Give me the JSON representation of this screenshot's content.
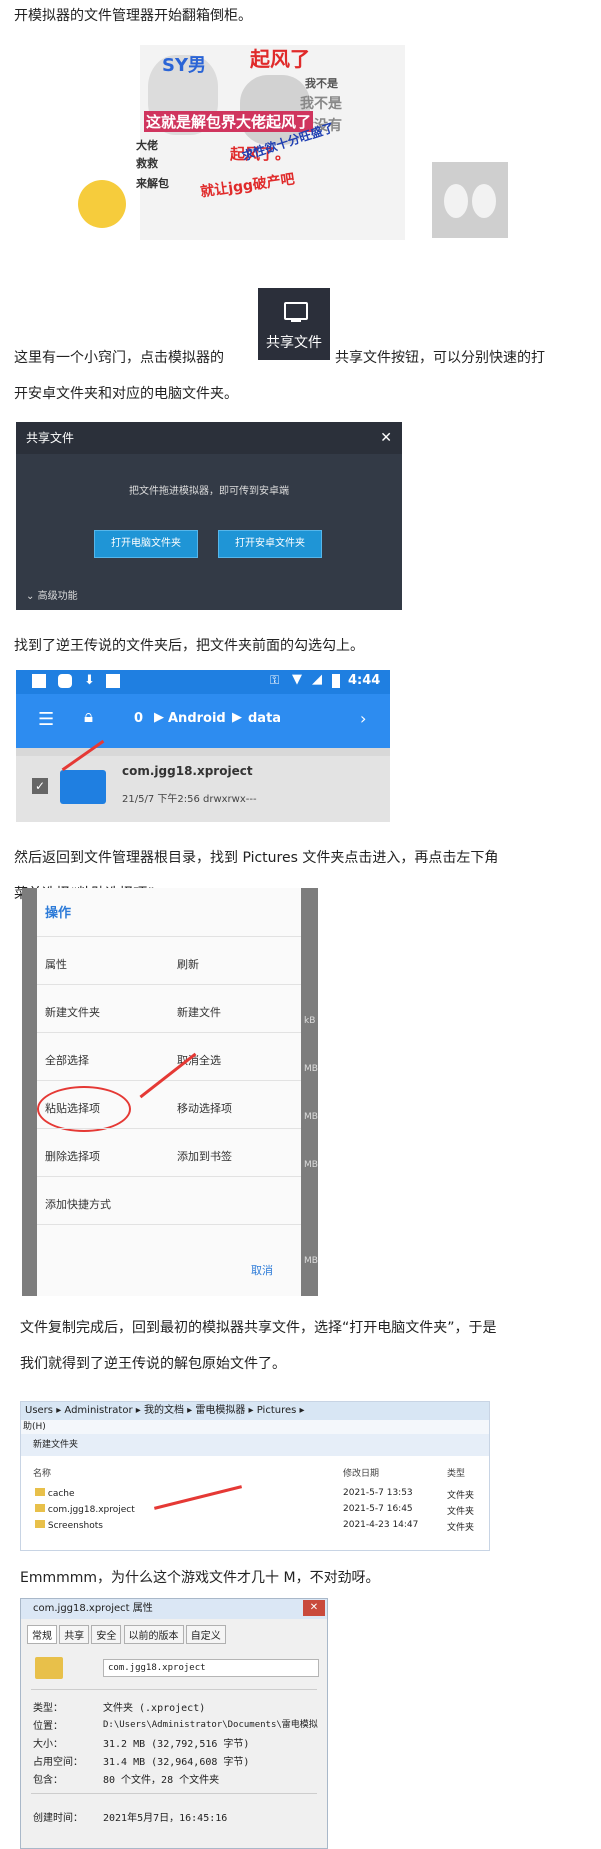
{
  "paragraphs": {
    "p1": "开模拟器的文件管理器开始翻箱倒柜。",
    "p2a": "这里有一个小窍门，点击模拟器的",
    "p2b": "共享文件按钮，可以分别快速的打",
    "p2c": "开安卓文件夹和对应的电脑文件夹。",
    "p3": "找到了逆王传说的文件夹后，把文件夹前面的勾选勾上。",
    "p4a": "然后返回到文件管理器根目录，找到 Pictures 文件夹点击进入，再点击左下角",
    "p4b": "菜单选择“粘贴选择项”。",
    "p5a": "文件复制完成后，回到最初的模拟器共享文件，选择“打开电脑文件夹”，于是",
    "p5b": "我们就得到了逆王传说的解包原始文件了。",
    "p6": "Emmmmm，为什么这个游戏文件才几十 M，不对劲呀。"
  },
  "meme": {
    "t1": "SY男",
    "t2": "起风了",
    "t3": "这就是解包界大佬起风了",
    "t4": "我不是",
    "t5": "我不是",
    "t6": "我没有",
    "t7": "起风了。",
    "t8": "求性欲十分旺盛了",
    "t9": "就让jgg破产吧",
    "t10": "大佬",
    "t11": "救救",
    "t12": "来解包"
  },
  "share_icon": {
    "label": "共享文件"
  },
  "share_dialog": {
    "title": "共享文件",
    "message": "把文件拖进模拟器，即可传到安卓端",
    "btn_pc": "打开电脑文件夹",
    "btn_android": "打开安卓文件夹",
    "advanced": "高级功能"
  },
  "android": {
    "time": "4:44",
    "count": "0",
    "path1": "Android",
    "path2": "data",
    "folder_name": "com.jgg18.xproject",
    "folder_meta": "21/5/7 下午2:56  drwxrwx---"
  },
  "ops_menu": {
    "title": "操作",
    "items": [
      "属性",
      "刷新",
      "新建文件夹",
      "新建文件",
      "全部选择",
      "取消全选",
      "粘贴选择项",
      "移动选择项",
      "删除选择项",
      "添加到书签",
      "添加快捷方式"
    ],
    "cancel": "取消",
    "sizes": [
      "kB",
      "MB",
      "MB",
      "MB",
      "MB"
    ]
  },
  "explorer": {
    "breadcrumb": [
      "Users",
      "Administrator",
      "我的文档",
      "雷电模拟器",
      "Pictures"
    ],
    "menu": "助(H)",
    "new_folder": "新建文件夹",
    "col_name": "名称",
    "col_date": "修改日期",
    "col_type": "类型",
    "rows": [
      {
        "name": "cache",
        "date": "2021-5-7 13:53",
        "type": "文件夹"
      },
      {
        "name": "com.jgg18.xproject",
        "date": "2021-5-7 16:45",
        "type": "文件夹"
      },
      {
        "name": "Screenshots",
        "date": "2021-4-23 14:47",
        "type": "文件夹"
      }
    ]
  },
  "props": {
    "title": "com.jgg18.xproject 属性",
    "tabs": [
      "常规",
      "共享",
      "安全",
      "以前的版本",
      "自定义"
    ],
    "name_value": "com.jgg18.xproject",
    "rows": [
      {
        "label": "类型：",
        "value": "文件夹 (.xproject)"
      },
      {
        "label": "位置：",
        "value": "D:\\Users\\Administrator\\Documents\\雷电模拟"
      },
      {
        "label": "大小：",
        "value": "31.2 MB (32,792,516 字节)"
      },
      {
        "label": "占用空间：",
        "value": "31.4 MB (32,964,608 字节)"
      },
      {
        "label": "包含：",
        "value": "80 个文件，28 个文件夹"
      },
      {
        "label": "创建时间：",
        "value": "2021年5月7日，16:45:16"
      }
    ]
  }
}
